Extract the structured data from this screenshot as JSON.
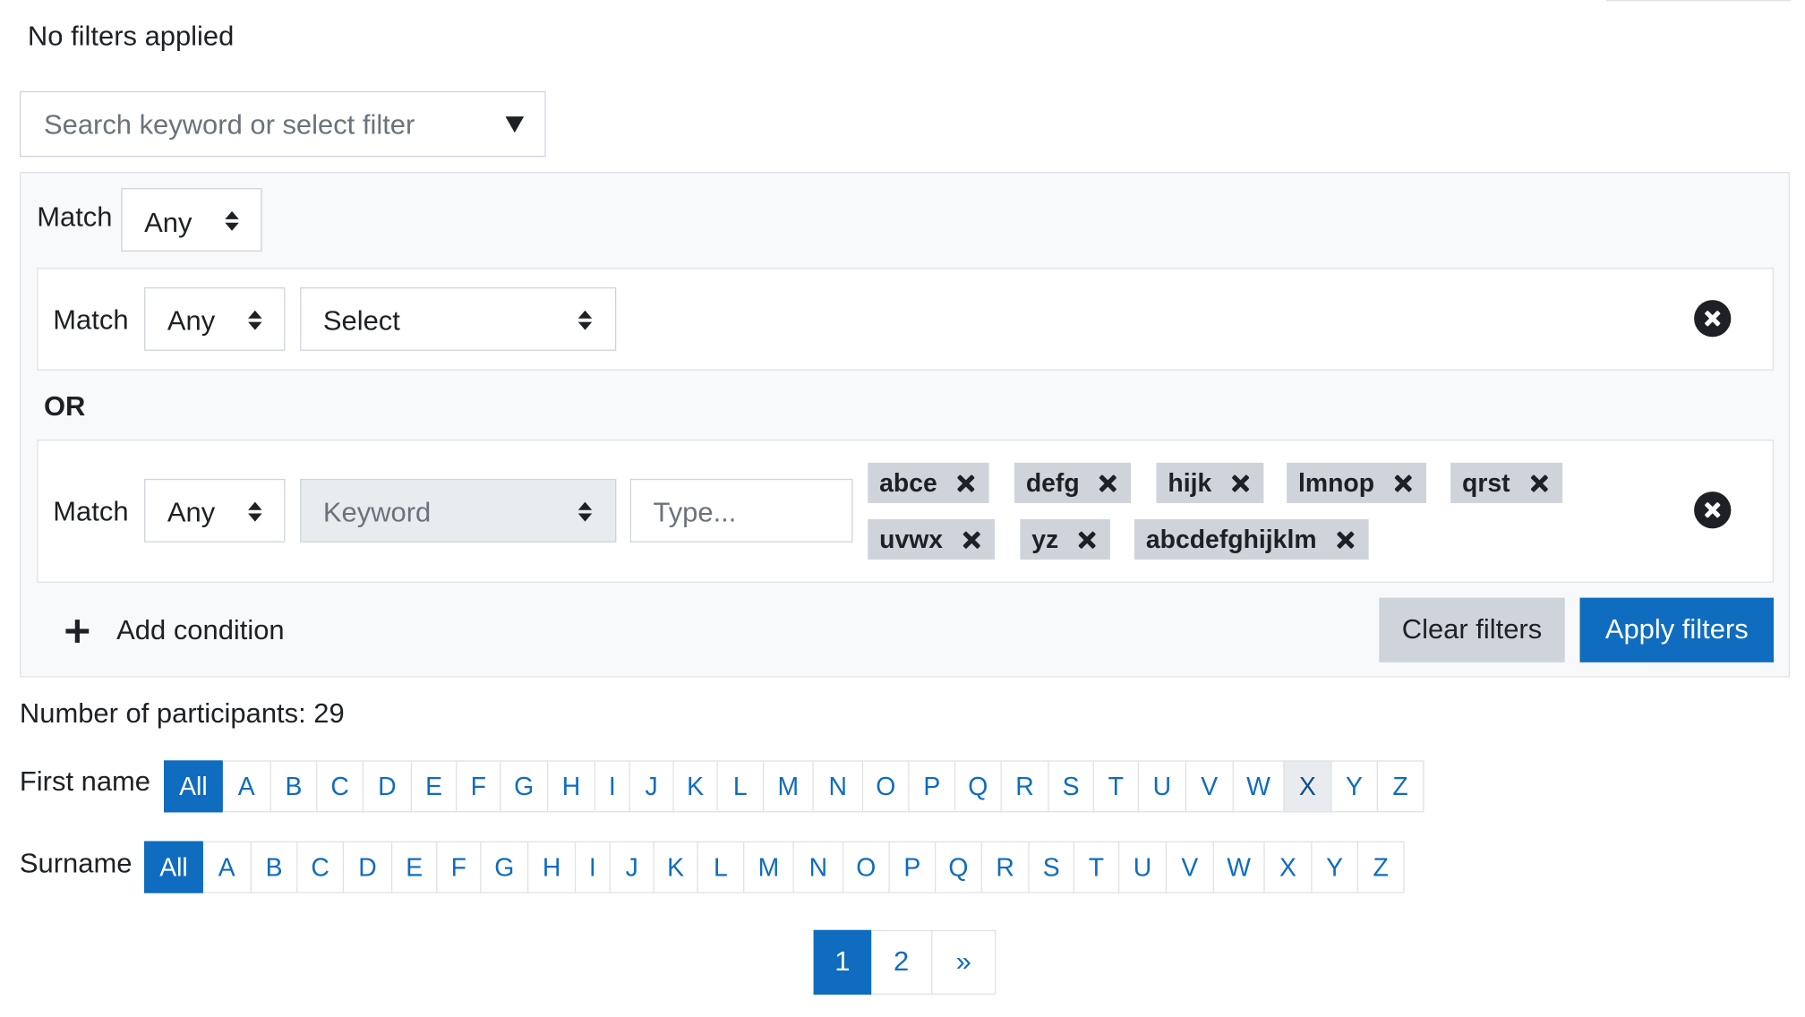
{
  "status": {
    "filters_text": "No filters applied"
  },
  "search": {
    "placeholder": "Search keyword or select filter",
    "dropdown_icon": "caret-down-icon"
  },
  "filterset": {
    "match_label": "Match",
    "match_value": "Any",
    "rows": [
      {
        "match_label": "Match",
        "match_value": "Any",
        "type_value": "Select",
        "remove_icon": "times-circle-icon"
      },
      {
        "match_label": "Match",
        "match_value": "Any",
        "type_value": "Keyword",
        "input_placeholder": "Type...",
        "remove_icon": "times-circle-icon",
        "chips": [
          "abce",
          "defg",
          "hijk",
          "lmnop",
          "qrst",
          "uvwx",
          "yz",
          "abcdefghijklm"
        ]
      }
    ],
    "joiner": "OR",
    "add_condition_label": "Add condition",
    "clear_label": "Clear filters",
    "apply_label": "Apply filters"
  },
  "participants": {
    "count_text": "Number of participants: 29"
  },
  "initials": {
    "first_label": "First name",
    "surname_label": "Surname",
    "all_label": "All",
    "letters": [
      "A",
      "B",
      "C",
      "D",
      "E",
      "F",
      "G",
      "H",
      "I",
      "J",
      "K",
      "L",
      "M",
      "N",
      "O",
      "P",
      "Q",
      "R",
      "S",
      "T",
      "U",
      "V",
      "W",
      "X",
      "Y",
      "Z"
    ]
  },
  "pagination": {
    "pages": [
      "1",
      "2"
    ],
    "next": "»",
    "current": "1"
  },
  "colors": {
    "primary": "#0f6cbf",
    "secondary": "#ced4da",
    "panel_bg": "#f8f9fa",
    "border": "#dee2e6",
    "text": "#1d2125"
  }
}
